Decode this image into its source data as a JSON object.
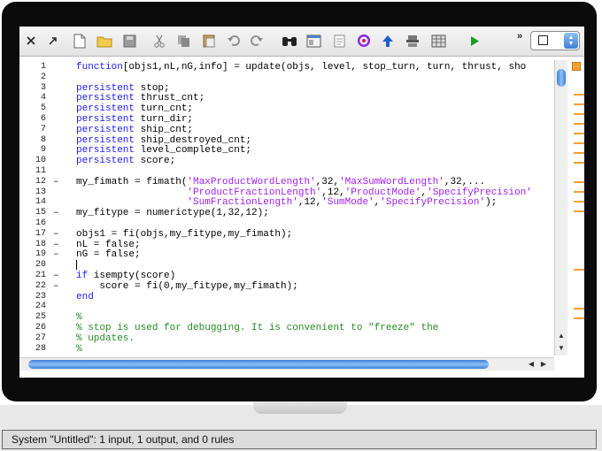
{
  "toolbar": {
    "overflow_label": "»",
    "icons": [
      "close-icon",
      "pin-icon",
      "new-file-icon",
      "open-folder-icon",
      "save-icon",
      "cut-icon",
      "copy-icon",
      "paste-icon",
      "undo-icon",
      "redo-icon",
      "find-icon",
      "window-icon",
      "document-icon",
      "target-icon",
      "up-arrow-icon",
      "layers-icon",
      "grid-icon",
      "run-icon"
    ]
  },
  "editor": {
    "lines": [
      {
        "n": "1",
        "d": "",
        "t": [
          [
            "kw",
            "function"
          ],
          [
            "",
            "[objs1,nL,nG,info] = update(objs, level, stop_turn, turn, thrust, sho"
          ]
        ]
      },
      {
        "n": "2",
        "d": "",
        "t": []
      },
      {
        "n": "3",
        "d": "",
        "t": [
          [
            "kw",
            "persistent"
          ],
          [
            "",
            " stop;"
          ]
        ]
      },
      {
        "n": "4",
        "d": "",
        "t": [
          [
            "kw",
            "persistent"
          ],
          [
            "",
            " thrust_cnt;"
          ]
        ]
      },
      {
        "n": "5",
        "d": "",
        "t": [
          [
            "kw",
            "persistent"
          ],
          [
            "",
            " turn_cnt;"
          ]
        ]
      },
      {
        "n": "6",
        "d": "",
        "t": [
          [
            "kw",
            "persistent"
          ],
          [
            "",
            " turn_dir;"
          ]
        ]
      },
      {
        "n": "7",
        "d": "",
        "t": [
          [
            "kw",
            "persistent"
          ],
          [
            "",
            " ship_cnt;"
          ]
        ]
      },
      {
        "n": "8",
        "d": "",
        "t": [
          [
            "kw",
            "persistent"
          ],
          [
            "",
            " ship_destroyed_cnt;"
          ]
        ]
      },
      {
        "n": "9",
        "d": "",
        "t": [
          [
            "kw",
            "persistent"
          ],
          [
            "",
            " level_complete_cnt;"
          ]
        ]
      },
      {
        "n": "10",
        "d": "",
        "t": [
          [
            "kw",
            "persistent"
          ],
          [
            "",
            " score;"
          ]
        ]
      },
      {
        "n": "11",
        "d": "",
        "t": []
      },
      {
        "n": "12",
        "d": "–",
        "t": [
          [
            "",
            "my_fimath = fimath("
          ],
          [
            "str",
            "'MaxProductWordLength'"
          ],
          [
            "",
            ",32,"
          ],
          [
            "str",
            "'MaxSumWordLength'"
          ],
          [
            "",
            ",32,..."
          ]
        ]
      },
      {
        "n": "13",
        "d": "",
        "t": [
          [
            "",
            "                   "
          ],
          [
            "str",
            "'ProductFractionLength'"
          ],
          [
            "",
            ",12,"
          ],
          [
            "str",
            "'ProductMode'"
          ],
          [
            "",
            ","
          ],
          [
            "str",
            "'SpecifyPrecision'"
          ]
        ]
      },
      {
        "n": "14",
        "d": "",
        "t": [
          [
            "",
            "                   "
          ],
          [
            "str",
            "'SumFractionLength'"
          ],
          [
            "",
            ",12,"
          ],
          [
            "str",
            "'SumMode'"
          ],
          [
            "",
            ","
          ],
          [
            "str",
            "'SpecifyPrecision'"
          ],
          [
            "",
            ");"
          ]
        ]
      },
      {
        "n": "15",
        "d": "–",
        "t": [
          [
            "",
            "my_fitype = numerictype(1,32,12);"
          ]
        ]
      },
      {
        "n": "16",
        "d": "",
        "t": []
      },
      {
        "n": "17",
        "d": "–",
        "t": [
          [
            "",
            "objs1 = fi(objs,my_fitype,my_fimath);"
          ]
        ]
      },
      {
        "n": "18",
        "d": "–",
        "t": [
          [
            "",
            "nL = false;"
          ]
        ]
      },
      {
        "n": "19",
        "d": "–",
        "t": [
          [
            "",
            "nG = false;"
          ]
        ]
      },
      {
        "n": "20",
        "d": "",
        "t": []
      },
      {
        "n": "21",
        "d": "–",
        "t": [
          [
            "kw",
            "if"
          ],
          [
            "",
            " isempty(score)"
          ]
        ]
      },
      {
        "n": "22",
        "d": "–",
        "t": [
          [
            "",
            "    score = fi(0,my_fitype,my_fimath);"
          ]
        ]
      },
      {
        "n": "23",
        "d": "",
        "t": [
          [
            "kw",
            "end"
          ]
        ]
      },
      {
        "n": "24",
        "d": "",
        "t": []
      },
      {
        "n": "25",
        "d": "",
        "t": [
          [
            "cmt",
            "%"
          ]
        ]
      },
      {
        "n": "26",
        "d": "",
        "t": [
          [
            "cmt",
            "% stop is used for debugging. It is convenient to \"freeze\" the"
          ]
        ]
      },
      {
        "n": "27",
        "d": "",
        "t": [
          [
            "cmt",
            "% updates."
          ]
        ]
      },
      {
        "n": "28",
        "d": "",
        "t": [
          [
            "cmt",
            "%"
          ]
        ]
      }
    ],
    "ruler_marks": [
      3,
      4,
      5,
      6,
      7,
      8,
      9,
      10,
      12,
      13,
      14,
      15,
      21,
      25,
      26
    ]
  },
  "status": {
    "text": "System \"Untitled\": 1 input, 1 output, and 0 rules"
  }
}
